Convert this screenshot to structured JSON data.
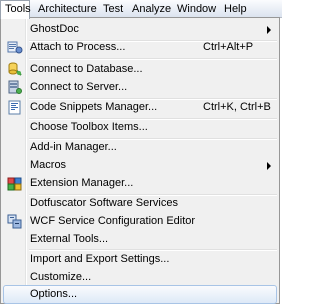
{
  "menubar": {
    "items": [
      {
        "label": "Tools"
      },
      {
        "label": "Architecture"
      },
      {
        "label": "Test"
      },
      {
        "label": "Analyze"
      },
      {
        "label": "Window"
      },
      {
        "label": "Help"
      }
    ]
  },
  "menu": {
    "items": [
      {
        "label": "GhostDoc",
        "shortcut": "",
        "submenu": true
      },
      {
        "label": "Attach to Process...",
        "shortcut": "Ctrl+Alt+P",
        "icon": "attach-process-icon"
      },
      {
        "label": "Connect to Database...",
        "shortcut": "",
        "icon": "connect-database-icon"
      },
      {
        "label": "Connect to Server...",
        "shortcut": "",
        "icon": "connect-server-icon"
      },
      {
        "label": "Code Snippets Manager...",
        "shortcut": "Ctrl+K, Ctrl+B",
        "icon": "code-snippets-icon"
      },
      {
        "label": "Choose Toolbox Items...",
        "shortcut": ""
      },
      {
        "label": "Add-in Manager...",
        "shortcut": ""
      },
      {
        "label": "Macros",
        "shortcut": "",
        "submenu": true
      },
      {
        "label": "Extension Manager...",
        "shortcut": "",
        "icon": "extension-manager-icon"
      },
      {
        "label": "Dotfuscator Software Services",
        "shortcut": ""
      },
      {
        "label": "WCF Service Configuration Editor",
        "shortcut": "",
        "icon": "wcf-editor-icon"
      },
      {
        "label": "External Tools...",
        "shortcut": ""
      },
      {
        "label": "Import and Export Settings...",
        "shortcut": ""
      },
      {
        "label": "Customize...",
        "shortcut": ""
      },
      {
        "label": "Options...",
        "shortcut": "",
        "highlighted": true
      }
    ]
  },
  "colors": {
    "highlight_border": "#a8c4e6",
    "menu_background": "#f0f0f0",
    "menubar_background": "#dbe3ef"
  }
}
